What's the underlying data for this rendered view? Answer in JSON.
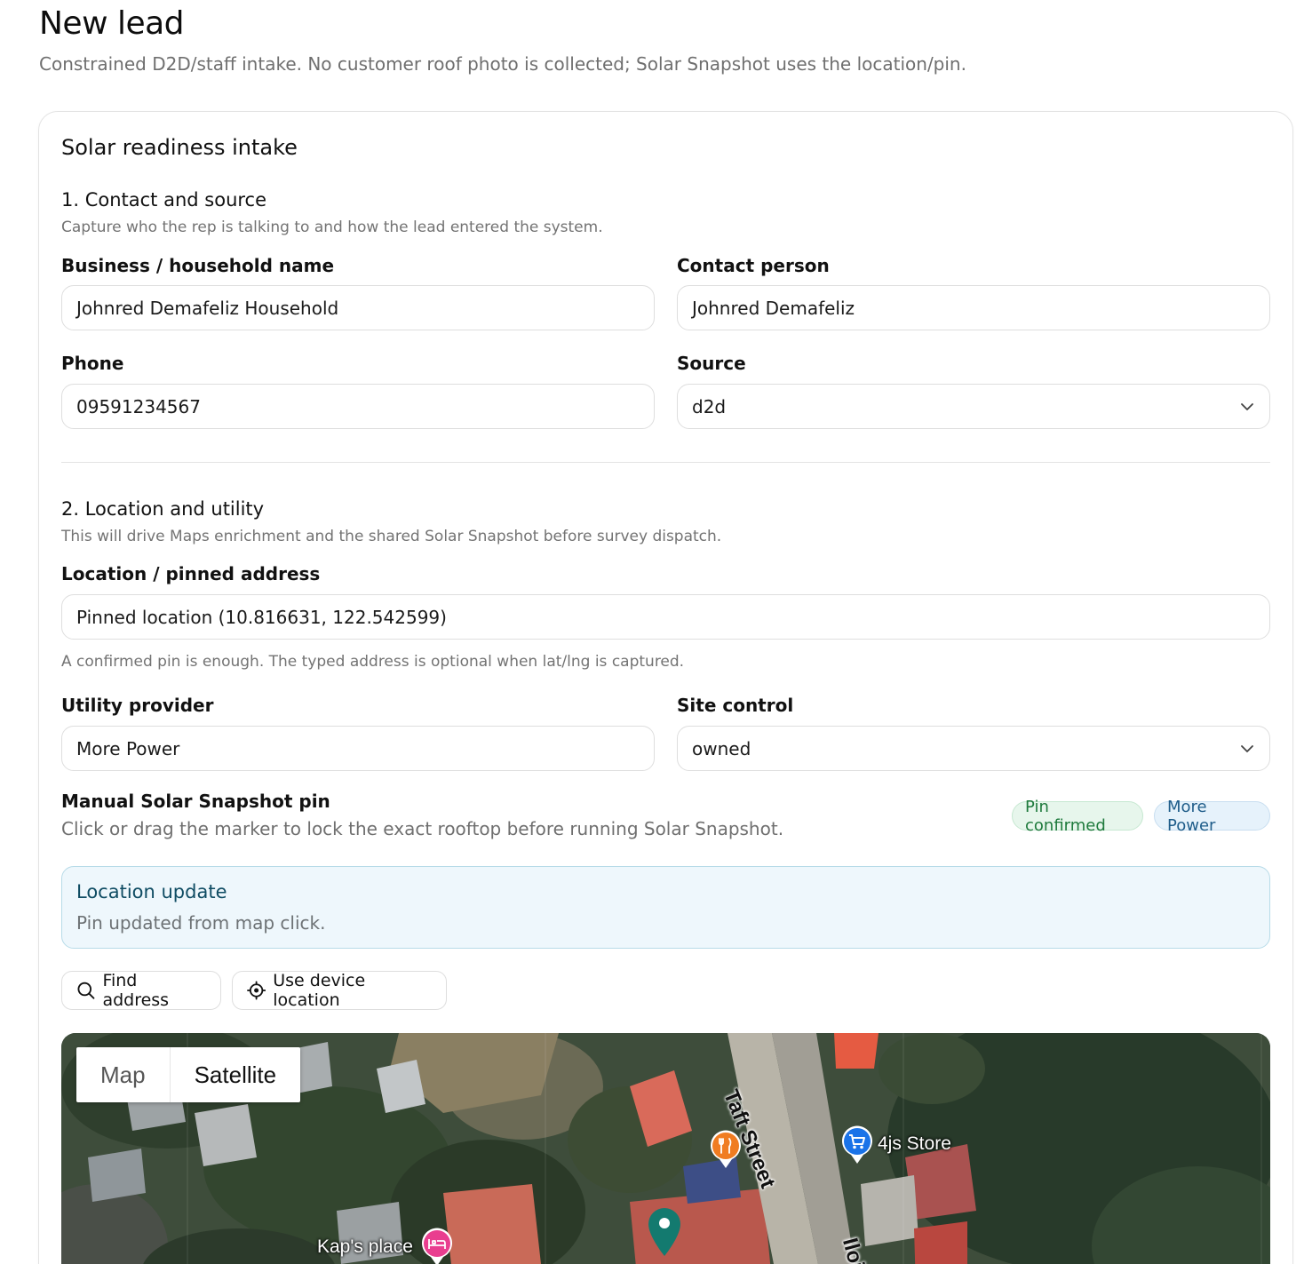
{
  "page": {
    "title": "New lead",
    "subtitle": "Constrained D2D/staff intake. No customer roof photo is collected; Solar Snapshot uses the location/pin."
  },
  "card": {
    "title": "Solar readiness intake"
  },
  "section1": {
    "title": "1. Contact and source",
    "hint": "Capture who the rep is talking to and how the lead entered the system.",
    "business_label": "Business / household name",
    "business_value": "Johnred Demafeliz Household",
    "contact_label": "Contact person",
    "contact_value": "Johnred Demafeliz",
    "phone_label": "Phone",
    "phone_value": "09591234567",
    "source_label": "Source",
    "source_value": "d2d"
  },
  "section2": {
    "title": "2. Location and utility",
    "hint": "This will drive Maps enrichment and the shared Solar Snapshot before survey dispatch.",
    "location_label": "Location / pinned address",
    "location_value": "Pinned location (10.816631, 122.542599)",
    "location_help": "A confirmed pin is enough. The typed address is optional when lat/lng is captured.",
    "utility_label": "Utility provider",
    "utility_value": "More Power",
    "site_label": "Site control",
    "site_value": "owned"
  },
  "pin": {
    "title": "Manual Solar Snapshot pin",
    "description": "Click or drag the marker to lock the exact rooftop before running Solar Snapshot.",
    "badge_confirmed": "Pin confirmed",
    "badge_utility": "More Power"
  },
  "alert": {
    "title": "Location update",
    "body": "Pin updated from map click."
  },
  "actions": {
    "find_address": "Find address",
    "use_device_location": "Use device location"
  },
  "map": {
    "toggle_map": "Map",
    "toggle_satellite": "Satellite",
    "street_taft": "Taft Street",
    "street_iloilo": "Iloi",
    "poi_store": "4js Store",
    "poi_kaps": "Kap's place",
    "colors": {
      "pin": "#137a6f",
      "restaurant": "#f07c21",
      "shop": "#1a73e8",
      "lodging": "#e93e8f"
    }
  },
  "icons": [
    "chevron-down-icon",
    "search-icon",
    "crosshair-icon",
    "map-pin-icon",
    "restaurant-icon",
    "shopping-cart-icon",
    "bed-icon"
  ]
}
